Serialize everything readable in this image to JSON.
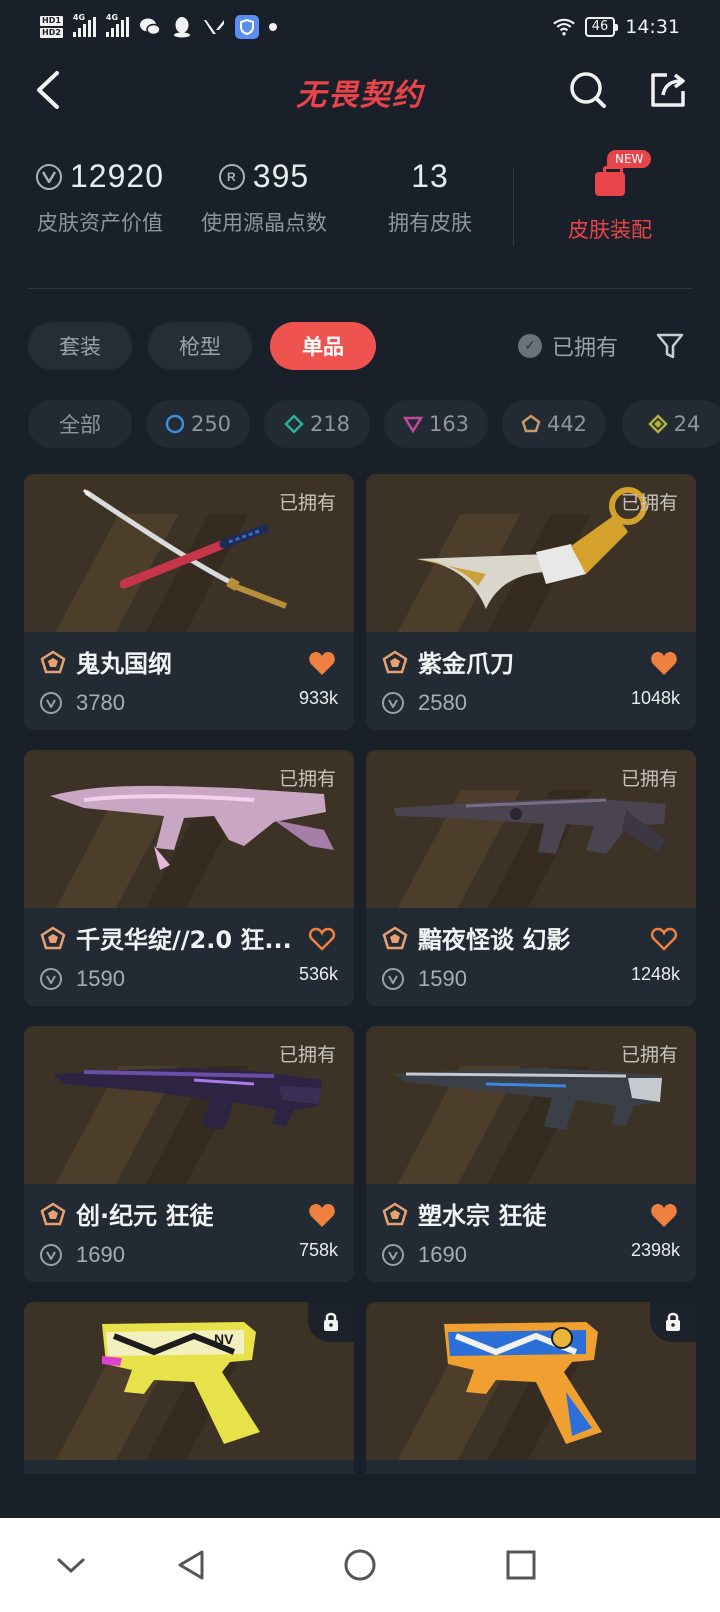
{
  "status_bar": {
    "hd1": "HD1",
    "hd2": "HD2",
    "net1": "4G",
    "net2": "4G",
    "battery": "46",
    "time": "14:31",
    "icons": [
      "wechat-icon",
      "qq-icon",
      "valorant-icon",
      "vpn-icon",
      "notification-dot",
      "wifi-icon"
    ]
  },
  "header": {
    "title": "无畏契约",
    "back_icon": "back-arrow-icon",
    "search_icon": "search-icon",
    "share_icon": "share-icon"
  },
  "stats": {
    "asset_value": "12920",
    "asset_label": "皮肤资产价值",
    "radianite_value": "395",
    "radianite_label": "使用源晶点数",
    "owned_value": "13",
    "owned_label": "拥有皮肤",
    "equip_badge": "NEW",
    "equip_label": "皮肤装配"
  },
  "tabs": {
    "items": [
      "套装",
      "枪型",
      "单品"
    ],
    "active": "单品",
    "owned_filter": "已拥有"
  },
  "tier_chips": {
    "all": "全部",
    "items": [
      {
        "count": "250",
        "color": "#3d8fd6"
      },
      {
        "count": "218",
        "color": "#2fae9a"
      },
      {
        "count": "163",
        "color": "#c34a9b"
      },
      {
        "count": "442",
        "color": "#c89a6a"
      },
      {
        "count": "24",
        "color": "#b3b03a"
      }
    ]
  },
  "cards": [
    {
      "name": "鬼丸国纲",
      "price": "3780",
      "likes": "933k",
      "owned": "已拥有",
      "liked": true,
      "tier_color": "#e8a070"
    },
    {
      "name": "紫金爪刀",
      "price": "2580",
      "likes": "1048k",
      "owned": "已拥有",
      "liked": true,
      "tier_color": "#e8a070"
    },
    {
      "name": "千灵华绽//2.0 狂...",
      "price": "1590",
      "likes": "536k",
      "owned": "已拥有",
      "liked": false,
      "tier_color": "#e8a070"
    },
    {
      "name": "黯夜怪谈 幻影",
      "price": "1590",
      "likes": "1248k",
      "owned": "已拥有",
      "liked": false,
      "tier_color": "#e8a070"
    },
    {
      "name": "创·纪元 狂徒",
      "price": "1690",
      "likes": "758k",
      "owned": "已拥有",
      "liked": true,
      "tier_color": "#e8a070"
    },
    {
      "name": "塑水宗 狂徒",
      "price": "1690",
      "likes": "2398k",
      "owned": "已拥有",
      "liked": true,
      "tier_color": "#e8a070"
    },
    {
      "name": "",
      "price": "",
      "likes": "",
      "owned": "",
      "liked": false,
      "locked": true
    },
    {
      "name": "",
      "price": "",
      "likes": "",
      "owned": "",
      "liked": false,
      "locked": true
    }
  ],
  "colors": {
    "accent": "#ef5350",
    "background": "#1a2029",
    "card": "#222a33",
    "heart": "#f08040"
  },
  "navbar": {
    "icons": [
      "nav-down-icon",
      "nav-back-icon",
      "nav-home-icon",
      "nav-recents-icon"
    ]
  }
}
